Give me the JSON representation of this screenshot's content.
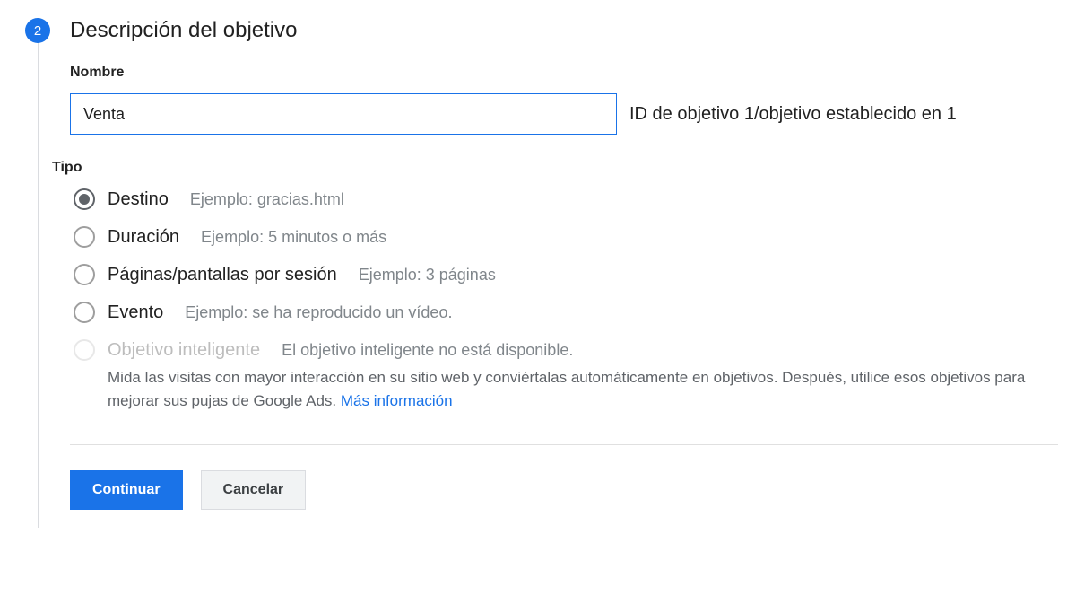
{
  "step": {
    "number": "2",
    "title": "Descripción del objetivo"
  },
  "fields": {
    "name_label": "Nombre",
    "name_value": "Venta",
    "id_text": "ID de objetivo 1/objetivo establecido en 1",
    "type_label": "Tipo"
  },
  "types": [
    {
      "label": "Destino",
      "example": "Ejemplo: gracias.html",
      "selected": true,
      "disabled": false
    },
    {
      "label": "Duración",
      "example": "Ejemplo: 5 minutos o más",
      "selected": false,
      "disabled": false
    },
    {
      "label": "Páginas/pantallas por sesión",
      "example": "Ejemplo: 3 páginas",
      "selected": false,
      "disabled": false
    },
    {
      "label": "Evento",
      "example": "Ejemplo: se ha reproducido un vídeo.",
      "selected": false,
      "disabled": false
    },
    {
      "label": "Objetivo inteligente",
      "example": "El objetivo inteligente no está disponible.",
      "selected": false,
      "disabled": true
    }
  ],
  "smart_desc": "Mida las visitas con mayor interacción en su sitio web y conviértalas automáticamente en objetivos. Después, utilice esos objetivos para mejorar sus pujas de Google Ads. ",
  "more_info": "Más información",
  "buttons": {
    "continue": "Continuar",
    "cancel": "Cancelar"
  }
}
